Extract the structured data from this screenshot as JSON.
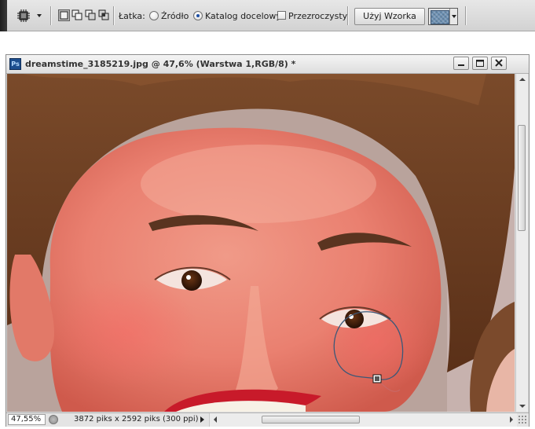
{
  "options_bar": {
    "tool_icon": "patch-tool-icon",
    "selection_modes": [
      "new-selection-icon",
      "add-to-selection-icon",
      "subtract-from-selection-icon",
      "intersect-selection-icon"
    ],
    "patch_label": "Łatka:",
    "source_label": "Źródło",
    "destination_label": "Katalog docelowy",
    "transparent_label": "Przezroczysty",
    "use_pattern_button": "Użyj Wzorka",
    "pattern_color": "#6b8fb2",
    "selected_patch_mode": "Katalog docelowy",
    "transparent_checked": false
  },
  "document": {
    "title": "dreamstime_3185219.jpg @ 47,6% (Warstwa 1,RGB/8) *",
    "app_icon_text": "Ps",
    "window_buttons": [
      "minimize-icon",
      "maximize-icon",
      "close-icon"
    ]
  },
  "status_bar": {
    "zoom": "47,55%",
    "doc_info": "3872 piks x 2592 piks (300 ppi)"
  },
  "scrollbars": {
    "vertical_position": 0.2,
    "horizontal_position": 0.35
  }
}
